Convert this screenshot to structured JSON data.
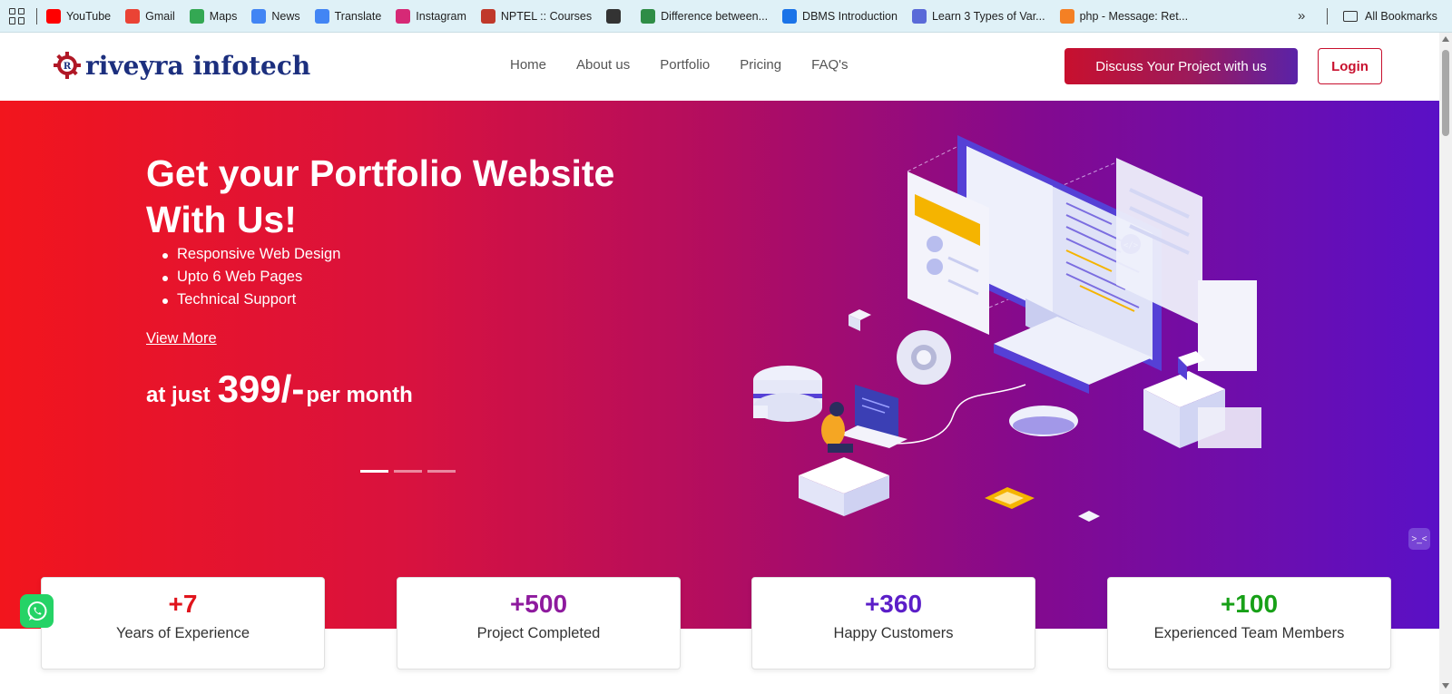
{
  "bookmarks": {
    "items": [
      {
        "label": "YouTube",
        "icon": "youtube-icon",
        "color": "#ff0000"
      },
      {
        "label": "Gmail",
        "icon": "gmail-icon",
        "color": "#ea4335"
      },
      {
        "label": "Maps",
        "icon": "maps-icon",
        "color": "#34a853"
      },
      {
        "label": "News",
        "icon": "news-icon",
        "color": "#4285f4"
      },
      {
        "label": "Translate",
        "icon": "translate-icon",
        "color": "#4285f4"
      },
      {
        "label": "Instagram",
        "icon": "instagram-icon",
        "color": "#d62976"
      },
      {
        "label": "NPTEL :: Courses",
        "icon": "nptel-icon",
        "color": "#c0392b"
      },
      {
        "label": "",
        "icon": "globe-icon",
        "color": "#333333"
      },
      {
        "label": "Difference between...",
        "icon": "gfg-icon",
        "color": "#2f8d46"
      },
      {
        "label": "DBMS Introduction",
        "icon": "w-icon",
        "color": "#1a73e8"
      },
      {
        "label": "Learn 3 Types of Var...",
        "icon": "edge-icon",
        "color": "#5a6ad8"
      },
      {
        "label": "php - Message: Ret...",
        "icon": "php-icon",
        "color": "#f48024"
      }
    ],
    "more": "»",
    "all_bookmarks": "All Bookmarks"
  },
  "nav": {
    "logo": {
      "brand": "riveyra",
      "brand2": "infotech"
    },
    "links": [
      "Home",
      "About us",
      "Portfolio",
      "Pricing",
      "FAQ's"
    ],
    "cta": "Discuss Your Project with us",
    "login": "Login"
  },
  "hero": {
    "title": "Get your Portfolio Website With Us!",
    "features": [
      "Responsive Web Design",
      "Upto 6 Web Pages",
      "Technical Support"
    ],
    "view_more": "View More",
    "price_prefix": "at just",
    "price": "399/-",
    "price_suffix": "per month",
    "slides_total": 3,
    "slide_active": 1,
    "chat_widget_label": ">_<"
  },
  "stats": [
    {
      "value": "+7",
      "label": "Years of Experience",
      "color": "#e0141c"
    },
    {
      "value": "+500",
      "label": "Project Completed",
      "color": "#8e1a9e"
    },
    {
      "value": "+360",
      "label": "Happy Customers",
      "color": "#5b1ec8"
    },
    {
      "value": "+100",
      "label": "Experienced Team Members",
      "color": "#17a017"
    }
  ],
  "colors": {
    "brand_red": "#c8102e",
    "brand_purple": "#5a10c6",
    "bookmark_bar": "#dff1f7"
  }
}
